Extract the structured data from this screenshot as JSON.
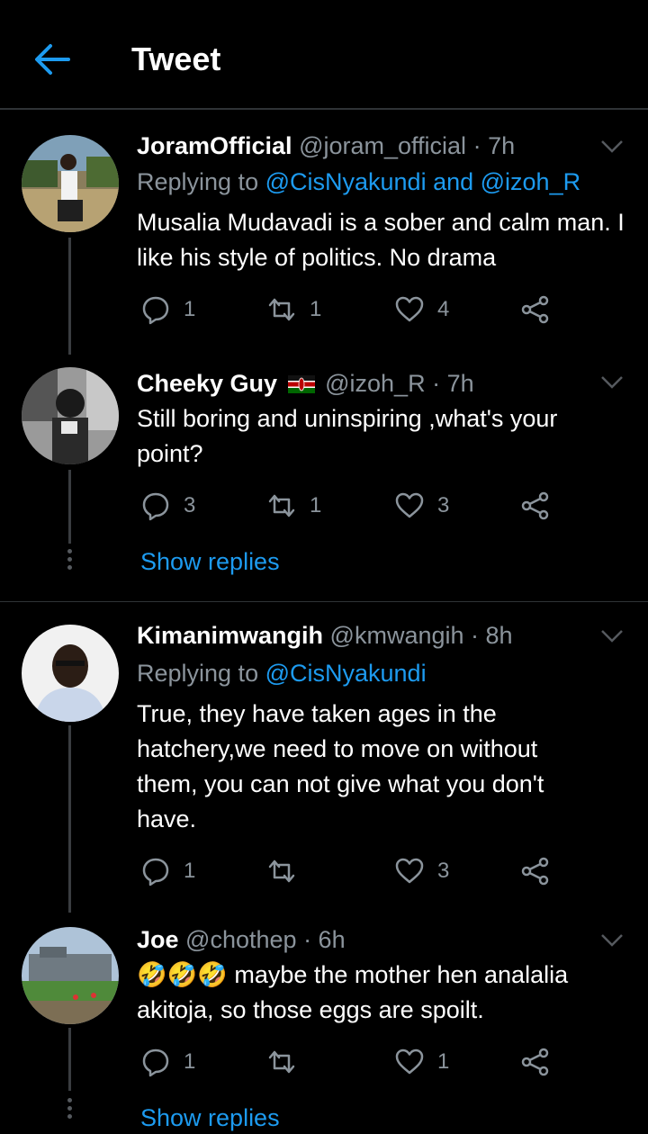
{
  "header": {
    "title": "Tweet"
  },
  "tweets": [
    {
      "name": "JoramOfficial",
      "handle": "@joram_official",
      "time": "· 7h",
      "replying_prefix": "Replying to",
      "replying_users": "@CisNyakundi and @izoh_R",
      "text": "Musalia Mudavadi is a sober and calm man. I like his style of politics. No drama",
      "replies": "1",
      "retweets": "1",
      "likes": "4"
    },
    {
      "name": "Cheeky Guy",
      "handle": "@izoh_R",
      "time": "· 7h",
      "text": "Still boring and uninspiring ,what's your point?",
      "replies": "3",
      "retweets": "1",
      "likes": "3",
      "show_replies": "Show replies"
    },
    {
      "name": "Kimanimwangih",
      "handle": "@kmwangih",
      "time": "· 8h",
      "replying_prefix": "Replying to",
      "replying_users": "@CisNyakundi",
      "text": "True, they have taken ages in the hatchery,we need to move on without them, you can not give what you don't have.",
      "replies": "1",
      "retweets": "",
      "likes": "3"
    },
    {
      "name": "Joe",
      "handle": "@chothep",
      "time": "· 6h",
      "emoji": "🤣🤣🤣",
      "text": " maybe the mother hen analalia akitoja, so those eggs are spoilt.",
      "replies": "1",
      "retweets": "",
      "likes": "1",
      "show_replies": "Show replies"
    }
  ],
  "colors": {
    "accent": "#1d9bf0",
    "muted": "#8b949c",
    "background": "#000000"
  }
}
